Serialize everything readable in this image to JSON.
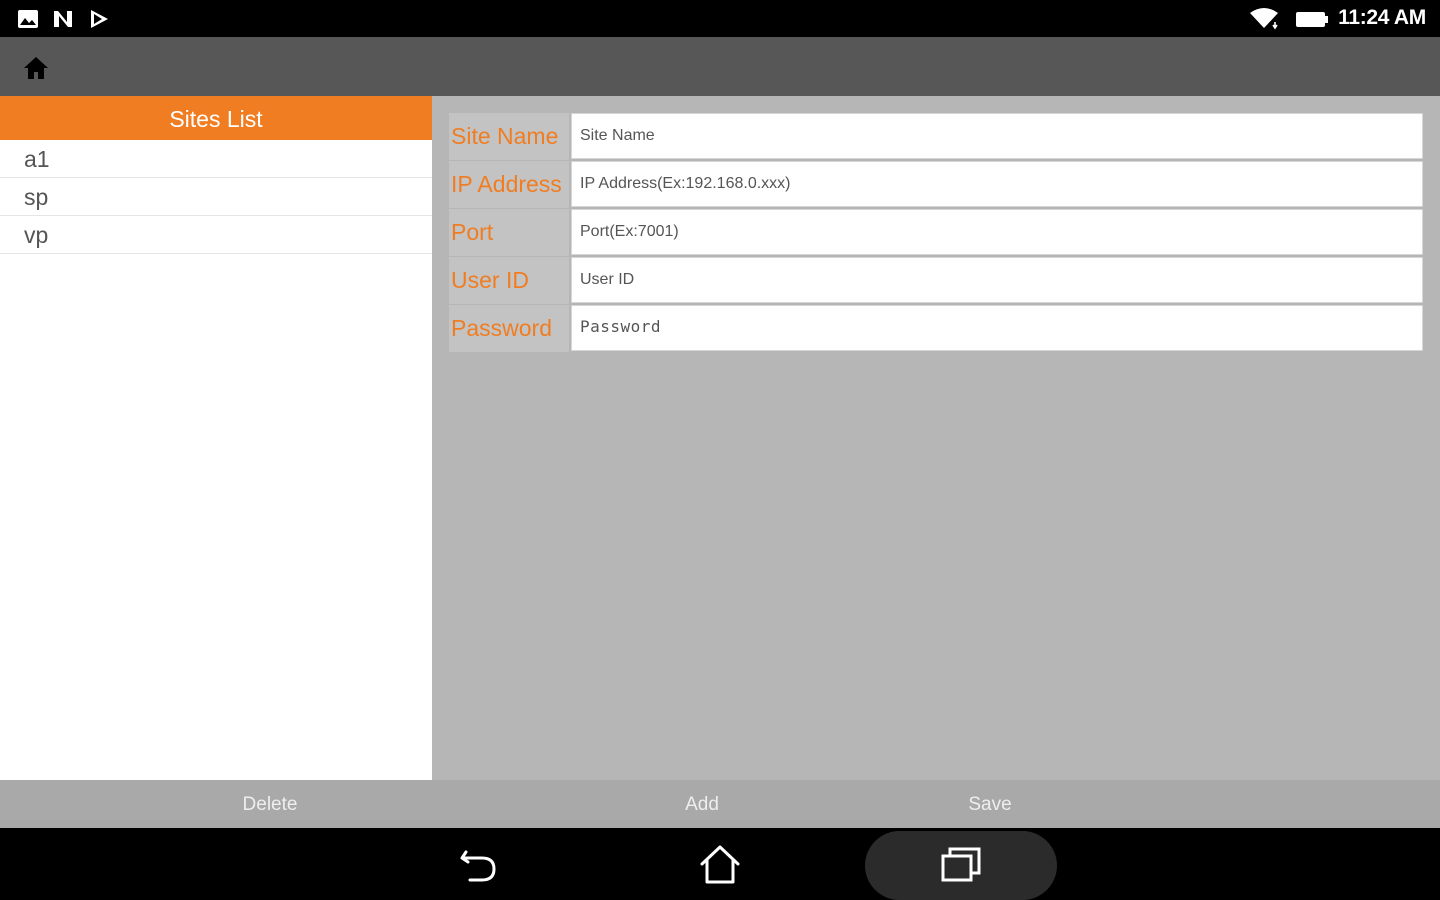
{
  "status_bar": {
    "time": "11:24 AM",
    "left_icons": [
      "gallery-notification-icon",
      "n-notification-icon",
      "play-store-notification-icon"
    ],
    "right_icons": [
      "wifi-icon",
      "battery-icon"
    ]
  },
  "action_bar": {
    "home_icon": "home-icon"
  },
  "sites_list": {
    "header": "Sites List",
    "items": [
      {
        "label": "a1"
      },
      {
        "label": "sp"
      },
      {
        "label": "vp"
      }
    ]
  },
  "form": {
    "fields": [
      {
        "label": "Site Name",
        "value": "",
        "placeholder": "Site Name"
      },
      {
        "label": "IP Address",
        "value": "",
        "placeholder": "IP Address(Ex:192.168.0.xxx)"
      },
      {
        "label": "Port",
        "value": "",
        "placeholder": "Port(Ex:7001)"
      },
      {
        "label": "User ID",
        "value": "",
        "placeholder": "User ID"
      },
      {
        "label": "Password",
        "value": "",
        "placeholder": "Password"
      }
    ]
  },
  "buttons": {
    "delete": "Delete",
    "add": "Add",
    "save": "Save"
  },
  "nav_bar": {
    "icons": [
      "back-icon",
      "nav-home-icon",
      "recent-apps-icon"
    ]
  },
  "colors": {
    "accent": "#f07d22",
    "action_bar": "#575757",
    "content_bg": "#b6b6b6"
  }
}
